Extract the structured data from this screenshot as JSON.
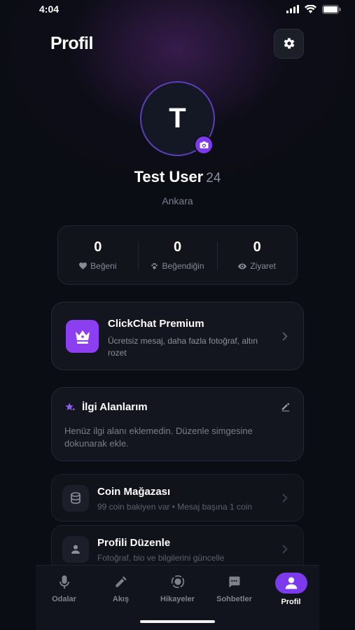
{
  "status": {
    "time": "4:04"
  },
  "header": {
    "title": "Profil"
  },
  "profile": {
    "initial": "T",
    "name": "Test User",
    "age": "24",
    "city": "Ankara"
  },
  "stats": [
    {
      "value": "0",
      "label": "Beğeni",
      "icon": "heart-icon"
    },
    {
      "value": "0",
      "label": "Beğendiğin",
      "icon": "paw-icon"
    },
    {
      "value": "0",
      "label": "Ziyaret",
      "icon": "eye-icon"
    }
  ],
  "premium": {
    "title": "ClickChat Premium",
    "desc": "Ücretsiz mesaj, daha fazla fotoğraf, altın rozet",
    "icon": "crown-icon"
  },
  "interests": {
    "title": "İlgi Alanlarım",
    "empty_text": "Henüz ilgi alanı eklemedin. Düzenle simgesine dokunarak ekle."
  },
  "menu": [
    {
      "title": "Coin Mağazası",
      "subtitle": "99 coin bakiyen var • Mesaj başına 1 coin",
      "icon": "coins-icon"
    },
    {
      "title": "Profili Düzenle",
      "subtitle": "Fotoğraf, bio ve bilgilerini güncelle",
      "icon": "user-edit-icon"
    }
  ],
  "tabs": [
    {
      "label": "Odalar",
      "icon": "mic-icon"
    },
    {
      "label": "Akış",
      "icon": "pen-icon"
    },
    {
      "label": "Hikayeler",
      "icon": "stories-icon"
    },
    {
      "label": "Sohbetler",
      "icon": "chat-icon"
    },
    {
      "label": "Profil",
      "icon": "user-icon",
      "active": true
    }
  ],
  "colors": {
    "accent": "#7c3aed",
    "background": "#0b0d14",
    "card": "#13151f"
  }
}
